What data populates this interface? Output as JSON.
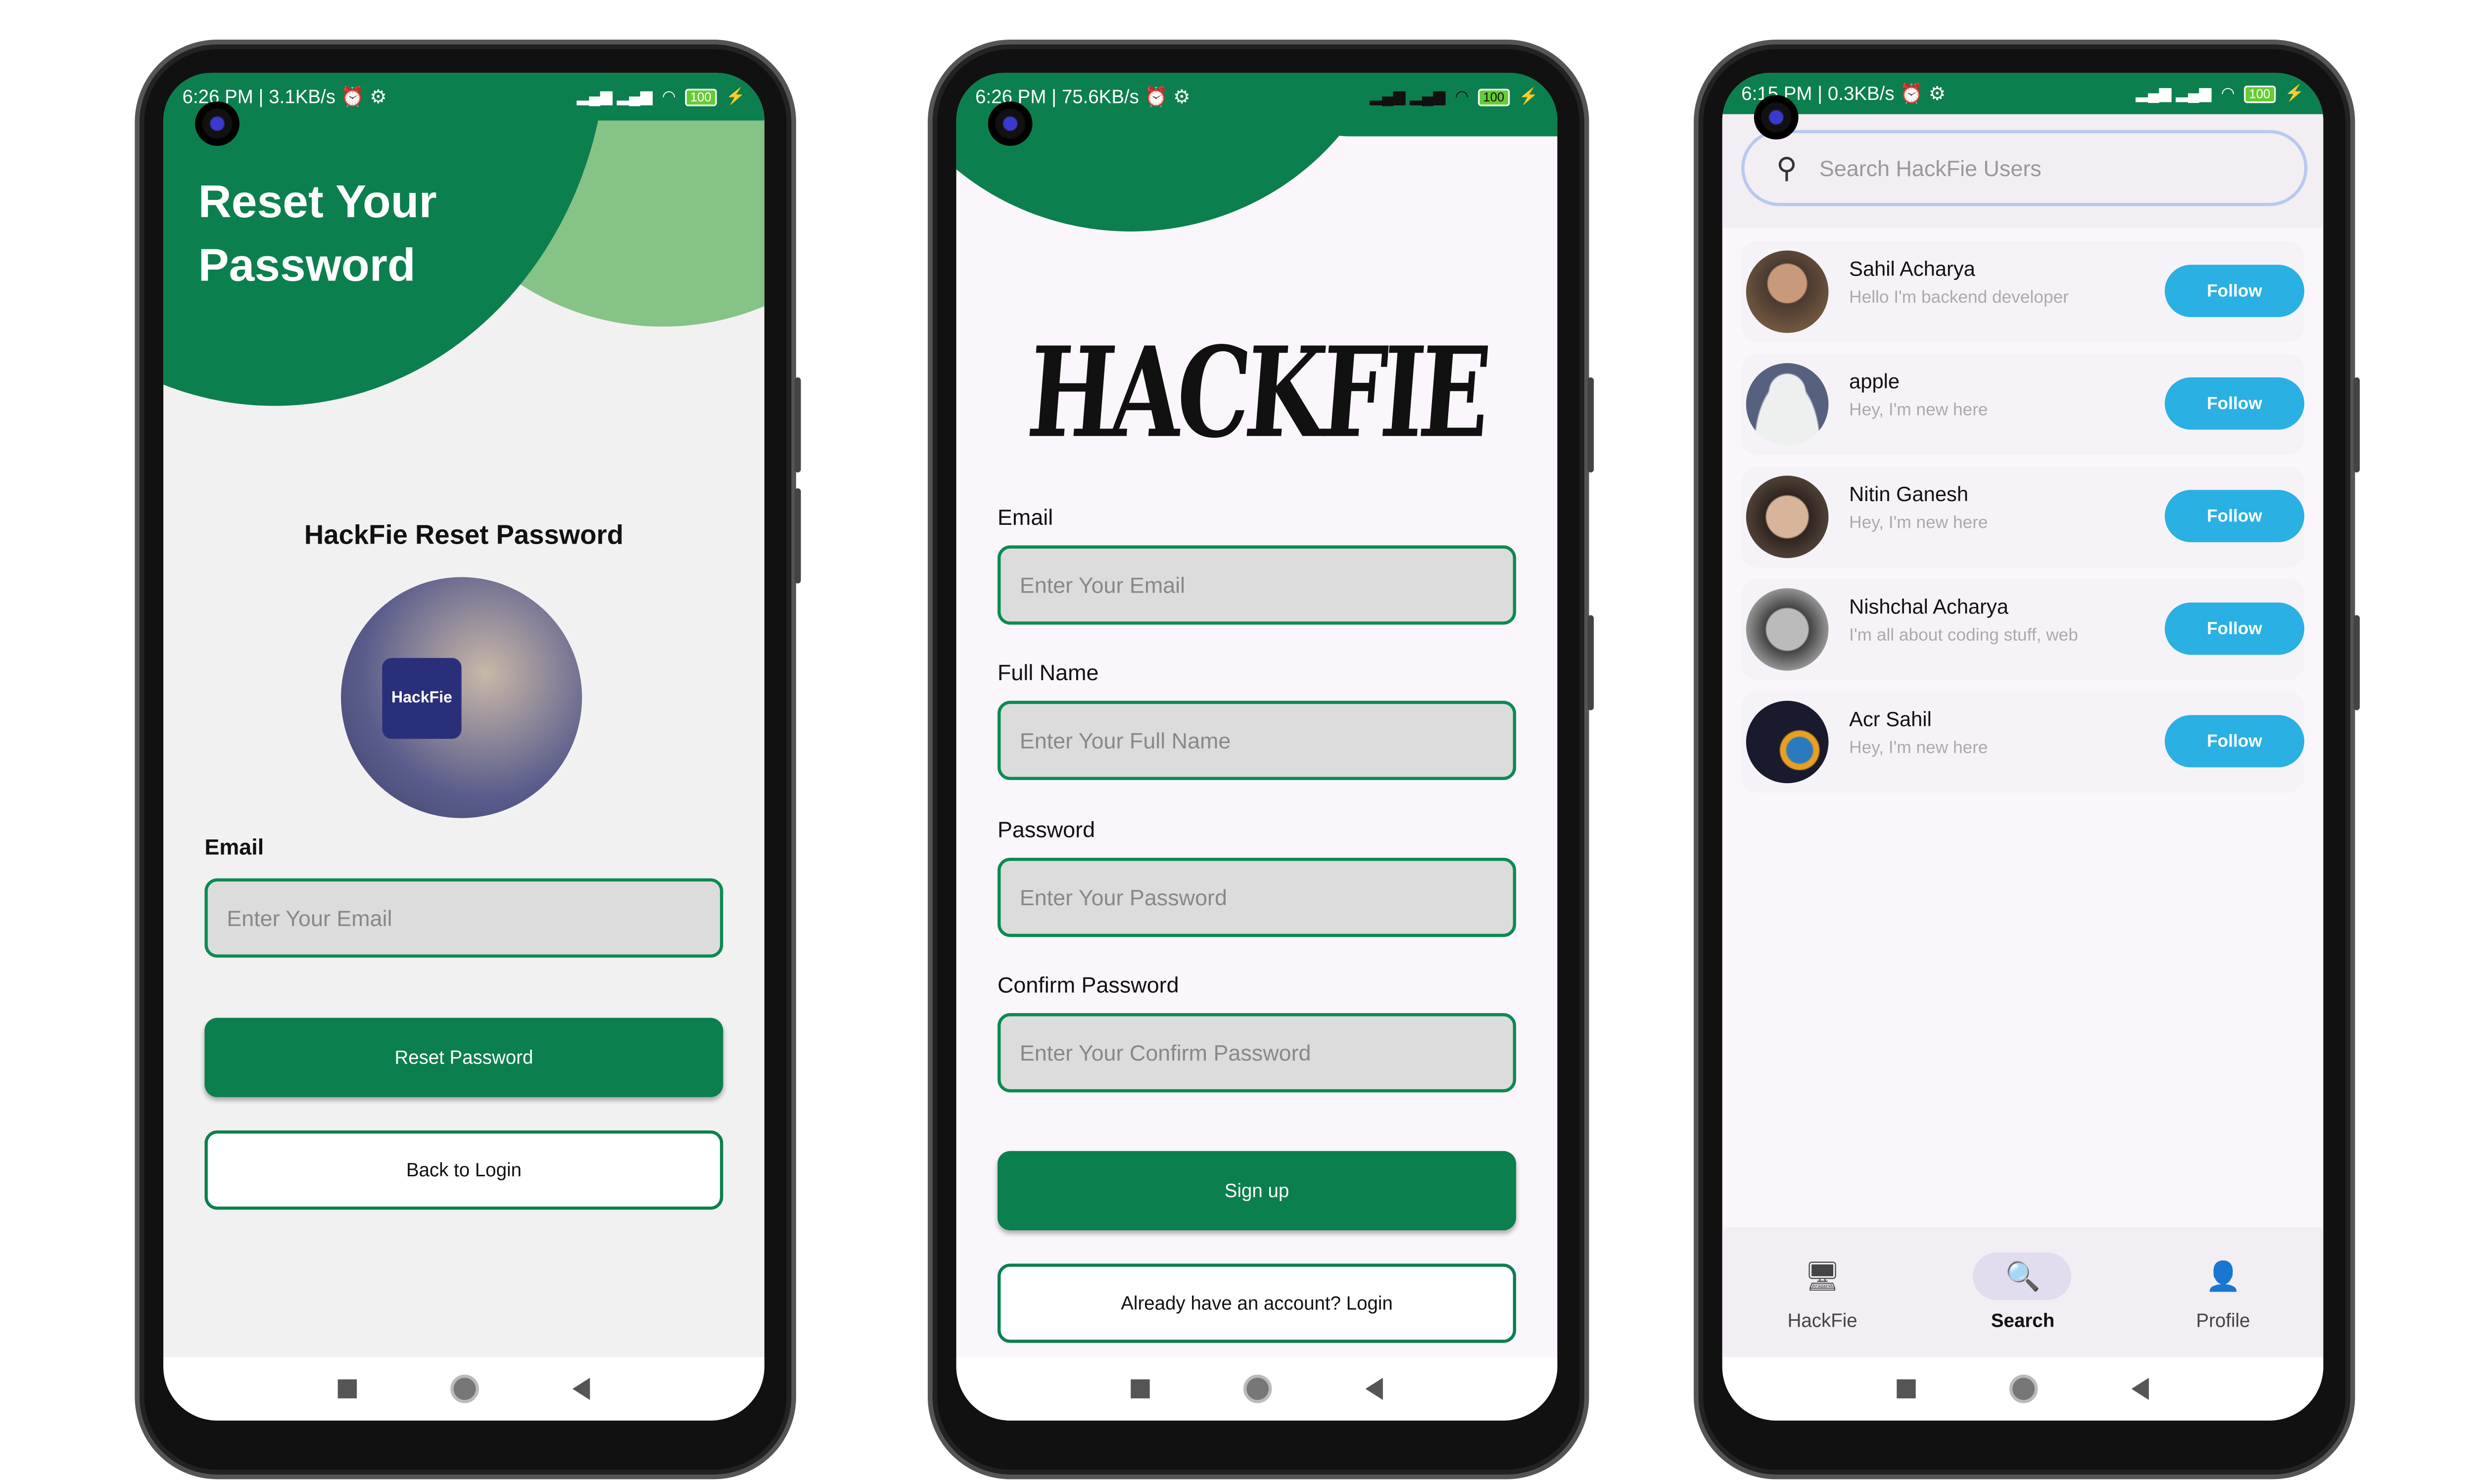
{
  "colors": {
    "primary_green": "#0c7f4e",
    "light_green": "#86c386",
    "follow_blue": "#2ab0e3"
  },
  "phone1": {
    "status": {
      "time": "6:26 PM",
      "speed": "3.1KB/s",
      "battery": "100"
    },
    "header_title_line1": "Reset Your",
    "header_title_line2": "Password",
    "subtitle": "HackFie Reset Password",
    "illustration_text": "HackFie",
    "email_label": "Email",
    "email_placeholder": "Enter Your Email",
    "reset_button": "Reset Password",
    "back_button": "Back to Login"
  },
  "phone2": {
    "status": {
      "time": "6:26 PM",
      "speed": "75.6KB/s",
      "battery": "100"
    },
    "logo": "HACKFIE",
    "fields": [
      {
        "label": "Email",
        "placeholder": "Enter Your Email"
      },
      {
        "label": "Full Name",
        "placeholder": "Enter Your Full Name"
      },
      {
        "label": "Password",
        "placeholder": "Enter Your Password"
      },
      {
        "label": "Confirm Password",
        "placeholder": "Enter Your Confirm Password"
      }
    ],
    "signup_button": "Sign up",
    "login_button": "Already have an account? Login"
  },
  "phone3": {
    "status": {
      "time": "6:15 PM",
      "speed": "0.3KB/s",
      "battery": "100"
    },
    "search_placeholder": "Search HackFie Users",
    "users": [
      {
        "name": "Sahil Acharya",
        "bio": "Hello I'm backend developer",
        "action": "Follow"
      },
      {
        "name": "apple",
        "bio": "Hey, I'm new here",
        "action": "Follow"
      },
      {
        "name": "Nitin Ganesh",
        "bio": "Hey, I'm new here",
        "action": "Follow"
      },
      {
        "name": "Nishchal Acharya",
        "bio": "I'm all about coding stuff, web",
        "action": "Follow"
      },
      {
        "name": "Acr Sahil",
        "bio": "Hey, I'm new here",
        "action": "Follow"
      }
    ],
    "tabs": [
      {
        "label": "HackFie",
        "icon": "monitor-icon",
        "active": false
      },
      {
        "label": "Search",
        "icon": "search-code-icon",
        "active": true
      },
      {
        "label": "Profile",
        "icon": "hacker-profile-icon",
        "active": false
      }
    ]
  }
}
